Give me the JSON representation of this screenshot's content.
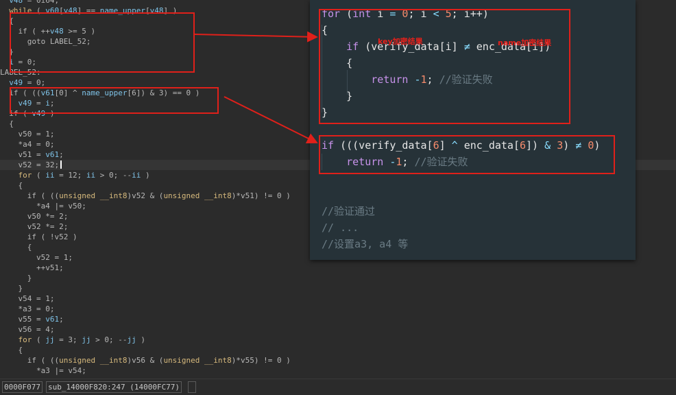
{
  "decompiler": {
    "lines": [
      {
        "t": "  v48 = 0i64;"
      },
      {
        "t": "  while ( v60[v48] == name_upper[v48] )"
      },
      {
        "t": "  {"
      },
      {
        "t": "    if ( ++v48 >= 5 )"
      },
      {
        "t": "      goto LABEL_52;"
      },
      {
        "t": "  }"
      },
      {
        "t": "  i = 0;"
      },
      {
        "t": "LABEL_52:"
      },
      {
        "t": "  v49 = 0;"
      },
      {
        "t": "  if ( ((v61[0] ^ name_upper[6]) & 3) == 0 )"
      },
      {
        "t": "    v49 = i;"
      },
      {
        "t": "  if ( v49 )"
      },
      {
        "t": "  {"
      },
      {
        "t": "    v50 = 1;"
      },
      {
        "t": "    *a4 = 0;"
      },
      {
        "t": "    v51 = v61;"
      },
      {
        "t": "    v52 = 32;"
      },
      {
        "t": "    for ( ii = 12; ii > 0; --ii )"
      },
      {
        "t": "    {"
      },
      {
        "t": "      if ( ((unsigned __int8)v52 & (unsigned __int8)*v51) != 0 )"
      },
      {
        "t": "        *a4 |= v50;"
      },
      {
        "t": "      v50 *= 2;"
      },
      {
        "t": "      v52 *= 2;"
      },
      {
        "t": "      if ( !v52 )"
      },
      {
        "t": "      {"
      },
      {
        "t": "        v52 = 1;"
      },
      {
        "t": "        ++v51;"
      },
      {
        "t": "      }"
      },
      {
        "t": "    }"
      },
      {
        "t": "    v54 = 1;"
      },
      {
        "t": "    *a3 = 0;"
      },
      {
        "t": "    v55 = v61;"
      },
      {
        "t": "    v56 = 4;"
      },
      {
        "t": "    for ( jj = 3; jj > 0; --jj )"
      },
      {
        "t": "    {"
      },
      {
        "t": "      if ( ((unsigned __int8)v56 & (unsigned __int8)*v55) != 0 )"
      },
      {
        "t": "        *a3 |= v54;"
      }
    ],
    "keywords": [
      "while",
      "for",
      "unsigned",
      "__int8"
    ],
    "identifiers": [
      "name_upper",
      "v60",
      "v48",
      "v61",
      "v49",
      "i",
      "ii",
      "jj"
    ],
    "current_line": 16
  },
  "status_bar": {
    "address": "0000F077",
    "location": "sub_14000F820:247 (14000FC77)",
    "extra": ""
  },
  "snippet": {
    "lines": [
      {
        "t": "for (int i = 0; i < 5; i++)"
      },
      {
        "t": "{"
      },
      {
        "t": "    if (verify_data[i] ≠ enc_data[i])"
      },
      {
        "t": "    {"
      },
      {
        "t": "        return -1; //验证失败"
      },
      {
        "t": "    }"
      },
      {
        "t": "}"
      },
      {
        "t": ""
      },
      {
        "t": "if (((verify_data[6] ^ enc_data[6]) & 3) ≠ 0)"
      },
      {
        "t": "    return -1; //验证失败"
      },
      {
        "t": ""
      },
      {
        "t": ""
      },
      {
        "t": "//验证通过"
      },
      {
        "t": "// ..."
      },
      {
        "t": "//设置a3, a4 等"
      }
    ],
    "keywords": [
      "for",
      "int",
      "if",
      "return"
    ]
  },
  "annotations": {
    "key_label": "key加密结果",
    "name_label": "name加密结果"
  },
  "colors": {
    "highlight_red": "#e0201a",
    "panel_bg": "#263238",
    "editor_bg": "#2b2b2b"
  }
}
